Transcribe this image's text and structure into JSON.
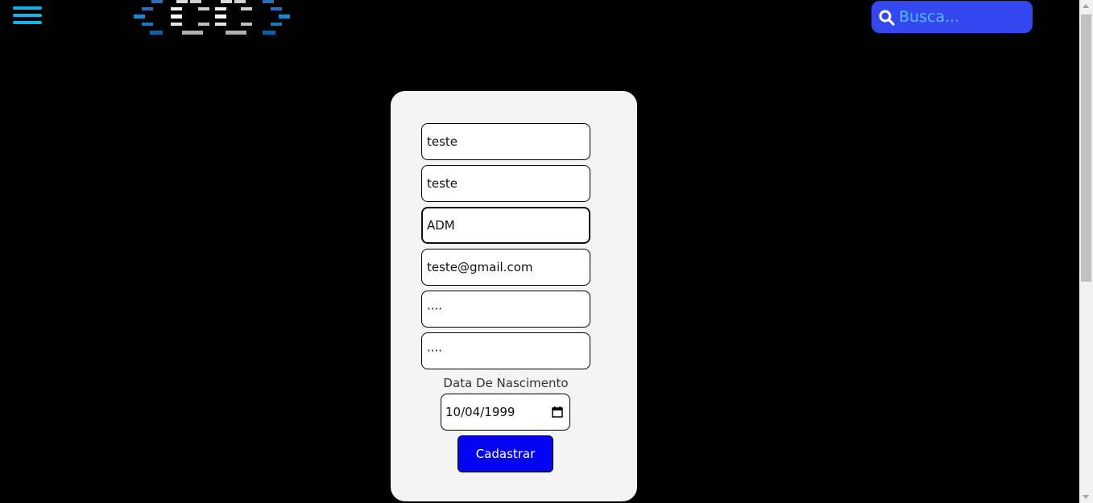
{
  "header": {
    "menu_icon": "hamburger-menu-icon",
    "logo_text": "{CC}",
    "search": {
      "icon": "search-icon",
      "placeholder": "Busca...",
      "color": "#3448f2"
    }
  },
  "form": {
    "fields": [
      {
        "value": "teste"
      },
      {
        "value": "teste"
      },
      {
        "value": "ADM"
      },
      {
        "value": "teste@gmail.com"
      },
      {
        "value": "····"
      },
      {
        "value": "····"
      }
    ],
    "dob_label": "Data De Nascimento",
    "dob_value": "10/04/1999",
    "submit_label": "Cadastrar",
    "submit_color": "#0404f2"
  },
  "colors": {
    "background": "#000000",
    "card": "#f4f4f4",
    "accent": "#12b3e8"
  }
}
